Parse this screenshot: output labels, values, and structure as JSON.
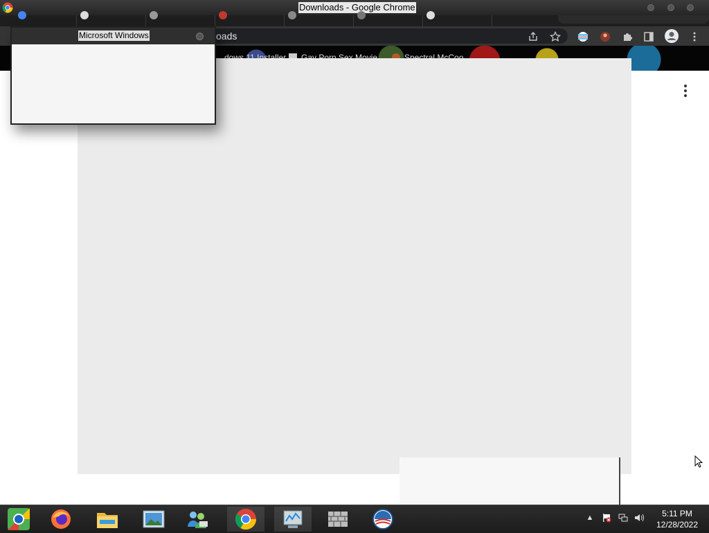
{
  "window": {
    "title": "Downloads - Google Chrome"
  },
  "browser": {
    "omnibox_text": "oads",
    "bookmarks": [
      "...dows 11 Installer",
      "Gay Porn Sex Movie",
      "Spectral McCoo"
    ]
  },
  "dialog": {
    "title": "Microsoft Windows"
  },
  "taskbar": {
    "apps": [
      "chrome-alt-icon",
      "firefox-icon",
      "file-explorer-icon",
      "photos-icon",
      "people-icon",
      "google-chrome-icon",
      "system-monitor-icon",
      "firewall-icon",
      "campaign-logo-icon"
    ],
    "tray_arrow": "▲",
    "time": "5:11 PM",
    "date": "12/28/2022"
  },
  "colors": {
    "taskbar_bg": "#1c1c1c",
    "toolbar_bg": "#353535",
    "overlay_bg": "#ebebeb"
  }
}
